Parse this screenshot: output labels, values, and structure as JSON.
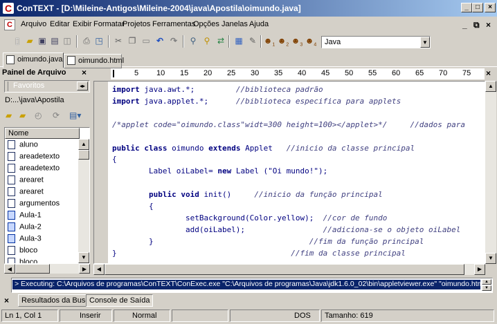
{
  "window": {
    "app_icon": "C",
    "title": "ConTEXT - [D:\\Mileine-Antigos\\Mileine-2004\\java\\Apostila\\oimundo.java]",
    "caption_buttons": [
      "_",
      "□",
      "×"
    ]
  },
  "menu": {
    "items": [
      "Arquivo",
      "Editar",
      "Exibir",
      "Formatar",
      "Projetos",
      "Ferramentas",
      "Opções",
      "Janelas",
      "Ajuda"
    ],
    "mdi_buttons": [
      "_",
      "⧉",
      "×"
    ]
  },
  "toolbar": {
    "icons": [
      "new-file-icon",
      "open-icon",
      "save-icon",
      "save-all-icon",
      "close-icon",
      "print-icon",
      "print-preview-icon",
      "cut-icon",
      "copy-icon",
      "paste-icon",
      "undo-icon",
      "redo-icon",
      "find-icon",
      "find-next-icon",
      "replace-icon",
      "export-icon",
      "tools-icon",
      "user-exec-1-icon",
      "user-exec-2-icon",
      "user-exec-3-icon",
      "user-exec-4-icon"
    ],
    "language_select": "Java"
  },
  "tabs": [
    "oimundo.java",
    "oimundo.html"
  ],
  "file_panel": {
    "title": "Painel de Arquivo",
    "favorites_tab": "Favoritos",
    "path": "D:...\\java\\Apostila",
    "column_header": "Nome",
    "files": [
      "aluno",
      "areadetexto",
      "areadetexto",
      "arearet",
      "arearet",
      "argumentos",
      "Aula-1",
      "Aula-2",
      "Aula-3",
      "bloco",
      "bloco"
    ]
  },
  "ruler": {
    "numbers": [
      "5",
      "10",
      "15",
      "20",
      "25",
      "30",
      "35",
      "40",
      "45",
      "50",
      "55",
      "60",
      "65",
      "70",
      "75"
    ]
  },
  "editor": {
    "lines": [
      {
        "parts": [
          {
            "t": "import",
            "c": "kw"
          },
          {
            "t": " java.awt.*;         "
          },
          {
            "t": "//biblioteca padrão",
            "c": "cm"
          }
        ]
      },
      {
        "parts": [
          {
            "t": "import",
            "c": "kw"
          },
          {
            "t": " java.applet.*;      "
          },
          {
            "t": "//biblioteca especifica para applets",
            "c": "cm"
          }
        ]
      },
      {
        "parts": []
      },
      {
        "parts": [
          {
            "t": "/*applet code=\"oimundo.class\"widt=300 height=100></applet>*/     //dados para",
            "c": "cm"
          }
        ]
      },
      {
        "parts": []
      },
      {
        "parts": [
          {
            "t": "public class",
            "c": "kw"
          },
          {
            "t": " oimundo "
          },
          {
            "t": "extends",
            "c": "kw"
          },
          {
            "t": " Applet   "
          },
          {
            "t": "//inicio da classe principal",
            "c": "cm"
          }
        ]
      },
      {
        "parts": [
          {
            "t": "{"
          }
        ]
      },
      {
        "parts": [
          {
            "t": "        Label oiLabel= "
          },
          {
            "t": "new",
            "c": "kw"
          },
          {
            "t": " Label (\"Oi mundo!\");"
          }
        ]
      },
      {
        "parts": []
      },
      {
        "parts": [
          {
            "t": "        "
          },
          {
            "t": "public void",
            "c": "kw"
          },
          {
            "t": " init()     "
          },
          {
            "t": "//inicio da função principal",
            "c": "cm"
          }
        ]
      },
      {
        "parts": [
          {
            "t": "        {"
          }
        ]
      },
      {
        "parts": [
          {
            "t": "                setBackground(Color.yellow);  "
          },
          {
            "t": "//cor de fundo",
            "c": "cm"
          }
        ]
      },
      {
        "parts": [
          {
            "t": "                add(oiLabel);                 "
          },
          {
            "t": "//adiciona-se o objeto oiLabel",
            "c": "cm"
          }
        ]
      },
      {
        "parts": [
          {
            "t": "        }                                  "
          },
          {
            "t": "//fim da função principal",
            "c": "cm"
          }
        ]
      },
      {
        "parts": [
          {
            "t": "}                                      "
          },
          {
            "t": "//fim da classe principal",
            "c": "cm"
          }
        ]
      }
    ]
  },
  "output": {
    "line": "> Executing: C:\\Arquivos de programas\\ConTEXT\\ConExec.exe \"C:\\Arquivos de programas\\Java\\jdk1.6.0_02\\bin\\appletviewer.exe\" \"oimundo.html\"",
    "tabs": [
      "Resultados da Busca",
      "Console de Saída"
    ]
  },
  "status": {
    "position": "Ln 1, Col 1",
    "insert_mode": "Inserir",
    "mode": "Normal",
    "encoding": "DOS",
    "size": "Tamanho: 619"
  }
}
